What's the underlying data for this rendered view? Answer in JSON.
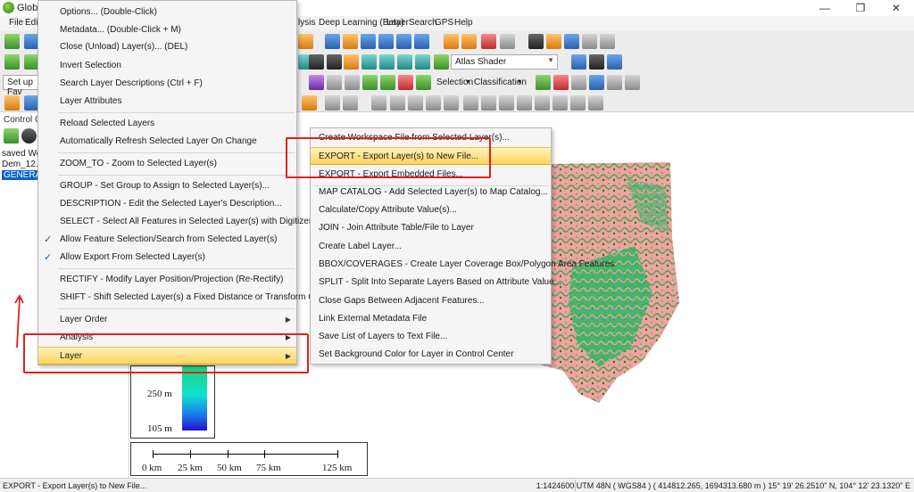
{
  "window": {
    "title": "Global M",
    "minimize": "—",
    "maximize": "❐",
    "close": "✕"
  },
  "menubar": {
    "left_items": [
      "File",
      "Edit"
    ],
    "right_items": [
      "lysis",
      "Deep Learning (Beta)",
      "Layer",
      "Search",
      "GPS",
      "Help"
    ]
  },
  "toolbar": {
    "shader_value": "Atlas Shader",
    "favorites_value": "Set up Fav",
    "selection_label": "Selection",
    "classification_label": "Classification"
  },
  "control_center": {
    "label": "Control Cent",
    "layers": [
      "saved Work",
      "Dem_12.5_S",
      "GENERATE"
    ]
  },
  "context_menu": {
    "items": [
      {
        "label": "Options... (Double-Click)"
      },
      {
        "label": "Metadata... (Double-Click + M)"
      },
      {
        "label": "Close (Unload) Layer(s)... (DEL)"
      },
      {
        "label": "Invert Selection"
      },
      {
        "label": "Search Layer Descriptions (Ctrl + F)"
      },
      {
        "label": "Layer Attributes"
      },
      {
        "label": "Reload Selected Layers"
      },
      {
        "label": "Automatically Refresh Selected Layer On Change"
      },
      {
        "label": "ZOOM_TO - Zoom to Selected Layer(s)"
      },
      {
        "label": "GROUP - Set Group to Assign to Selected Layer(s)..."
      },
      {
        "label": "DESCRIPTION - Edit the Selected Layer's Description..."
      },
      {
        "label": "SELECT - Select All Features in Selected Layer(s) with Digitizer Tool"
      },
      {
        "label": "Allow Feature Selection/Search from Selected Layer(s)",
        "checked": true
      },
      {
        "label": "Allow Export From Selected Layer(s)",
        "checked": true
      },
      {
        "label": "RECTIFY - Modify Layer Position/Projection (Re-Rectify)"
      },
      {
        "label": "SHIFT - Shift Selected Layer(s) a Fixed Distance or Transform Coordinates..."
      },
      {
        "label": "Layer Order",
        "submenu": true
      },
      {
        "label": "Analysis",
        "submenu": true
      },
      {
        "label": "Layer",
        "submenu": true,
        "highlighted": true
      }
    ],
    "check_mark": "✓",
    "submenu_arrow": "▶"
  },
  "layer_submenu": {
    "items": [
      {
        "label": "Create Workspace File from Selected Layer(s)..."
      },
      {
        "label": "EXPORT - Export Layer(s) to New File...",
        "highlighted": true
      },
      {
        "label": "EXPORT - Export Embedded Files..."
      },
      {
        "label": "MAP CATALOG - Add Selected Layer(s) to Map Catalog..."
      },
      {
        "label": "Calculate/Copy Attribute Value(s)..."
      },
      {
        "label": "JOIN - Join Attribute Table/File to Layer"
      },
      {
        "label": "Create Label Layer..."
      },
      {
        "label": "BBOX/COVERAGES - Create Layer Coverage Box/Polygon Area Features"
      },
      {
        "label": "SPLIT - Split Into Separate Layers Based on Attribute Value..."
      },
      {
        "label": "Close Gaps Between Adjacent Features..."
      },
      {
        "label": "Link External Metadata File"
      },
      {
        "label": "Save List of Layers to Text File..."
      },
      {
        "label": "Set Background Color for Layer in Control Center"
      }
    ]
  },
  "legend": {
    "labels": [
      "250 m",
      "105 m"
    ]
  },
  "scalebar": {
    "labels": [
      "0 km",
      "25 km",
      "50 km",
      "75 km",
      "125 km"
    ]
  },
  "status": {
    "left": "EXPORT - Export Layer(s) to New File...",
    "right": "1:1424600  UTM 48N ( WGS84 ) ( 414812.265, 1694313.680 m )  15° 19' 26.2510\" N, 104° 12' 23.1320\" E"
  },
  "colors": {
    "highlight": "#ffd45e",
    "selection_blue": "#0a64c8",
    "annotation_red": "#e02020"
  }
}
